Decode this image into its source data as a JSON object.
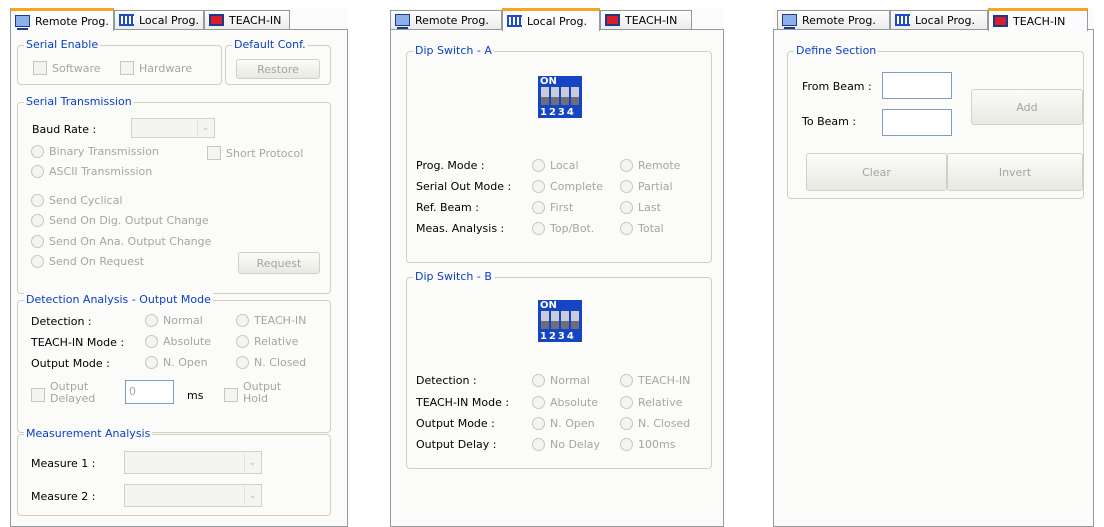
{
  "tabs": {
    "remote": "Remote Prog.",
    "local": "Local Prog.",
    "teach": "TEACH-IN"
  },
  "remote": {
    "serial_enable": {
      "title": "Serial Enable",
      "software": "Software",
      "hardware": "Hardware"
    },
    "default_conf": {
      "title": "Default Conf.",
      "restore": "Restore"
    },
    "serial_transmission": {
      "title": "Serial Transmission",
      "baud_rate_label": "Baud Rate :",
      "baud_rate_value": "",
      "binary": "Binary Transmission",
      "short_protocol": "Short Protocol",
      "ascii": "ASCII Transmission",
      "send_cyclical": "Send Cyclical",
      "send_dig": "Send On Dig. Output Change",
      "send_ana": "Send On Ana. Output Change",
      "send_request": "Send On Request",
      "request_button": "Request"
    },
    "detection": {
      "title": "Detection Analysis - Output Mode",
      "detection_label": "Detection :",
      "normal": "Normal",
      "teach_in": "TEACH-IN",
      "teach_mode_label": "TEACH-IN Mode :",
      "absolute": "Absolute",
      "relative": "Relative",
      "output_mode_label": "Output Mode :",
      "n_open": "N. Open",
      "n_closed": "N. Closed",
      "output_delayed_1": "Output",
      "output_delayed_2": "Delayed",
      "delay_value": "0",
      "ms": "ms",
      "output_hold_1": "Output",
      "output_hold_2": "Hold"
    },
    "measurement": {
      "title": "Measurement Analysis",
      "measure1": "Measure 1 :",
      "measure2": "Measure 2 :"
    }
  },
  "local": {
    "dip_a": {
      "title": "Dip Switch - A",
      "on": "ON",
      "nums": "1234",
      "rows": [
        {
          "label": "Prog. Mode :",
          "opt1": "Local",
          "opt2": "Remote"
        },
        {
          "label": "Serial Out Mode :",
          "opt1": "Complete",
          "opt2": "Partial"
        },
        {
          "label": "Ref. Beam :",
          "opt1": "First",
          "opt2": "Last"
        },
        {
          "label": "Meas. Analysis :",
          "opt1": "Top/Bot.",
          "opt2": "Total"
        }
      ]
    },
    "dip_b": {
      "title": "Dip Switch - B",
      "on": "ON",
      "nums": "1234",
      "rows": [
        {
          "label": "Detection :",
          "opt1": "Normal",
          "opt2": "TEACH-IN"
        },
        {
          "label": "TEACH-IN Mode :",
          "opt1": "Absolute",
          "opt2": "Relative"
        },
        {
          "label": "Output Mode :",
          "opt1": "N. Open",
          "opt2": "N. Closed"
        },
        {
          "label": "Output Delay :",
          "opt1": "No Delay",
          "opt2": "100ms"
        }
      ]
    }
  },
  "teach": {
    "section_title": "Define Section",
    "from_beam": "From Beam :",
    "to_beam": "To Beam :",
    "add": "Add",
    "clear": "Clear",
    "invert": "Invert"
  }
}
